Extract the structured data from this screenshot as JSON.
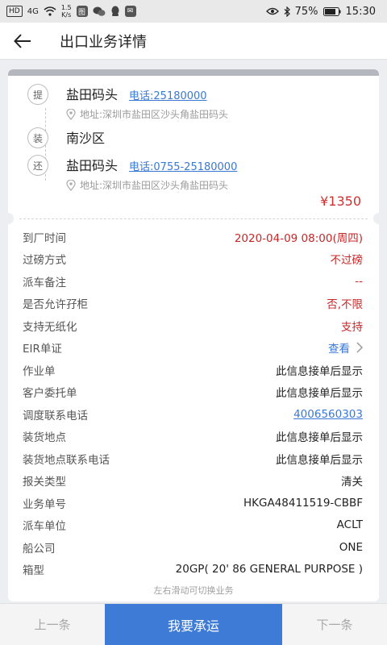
{
  "status_bar": {
    "hd_label": "HD",
    "network": "4G",
    "speed": "1.5\nK/s",
    "battery": "75%",
    "time": "15:30"
  },
  "header": {
    "title": "出口业务详情"
  },
  "route": {
    "pickup": {
      "badge": "提",
      "name": "盐田码头",
      "phone": "电话:25180000",
      "address": "地址:深圳市盐田区沙头角盐田码头"
    },
    "load": {
      "badge": "装",
      "name": "南沙区"
    },
    "return": {
      "badge": "还",
      "name": "盐田码头",
      "phone": "电话:0755-25180000",
      "address": "地址:深圳市盐田区沙头角盐田码头"
    },
    "price": "¥1350"
  },
  "details": [
    {
      "label": "到厂时间",
      "value": "2020-04-09 08:00(周四)",
      "style": "red"
    },
    {
      "label": "过磅方式",
      "value": "不过磅",
      "style": "red"
    },
    {
      "label": "派车备注",
      "value": "--",
      "style": "red"
    },
    {
      "label": "是否允许孖柜",
      "value": "否,不限",
      "style": "red"
    },
    {
      "label": "支持无纸化",
      "value": "支持",
      "style": "red"
    },
    {
      "label": "EIR单证",
      "value": "查看",
      "style": "blue-chevron"
    },
    {
      "label": "作业单",
      "value": "此信息接单后显示",
      "style": "normal"
    },
    {
      "label": "客户委托单",
      "value": "此信息接单后显示",
      "style": "normal"
    },
    {
      "label": "调度联系电话",
      "value": "4006560303",
      "style": "link"
    },
    {
      "label": "装货地点",
      "value": "此信息接单后显示",
      "style": "normal"
    },
    {
      "label": "装货地点联系电话",
      "value": "此信息接单后显示",
      "style": "normal"
    },
    {
      "label": "报关类型",
      "value": "清关",
      "style": "normal"
    },
    {
      "label": "业务单号",
      "value": "HKGA48411519-CBBF",
      "style": "normal"
    },
    {
      "label": "派车单位",
      "value": "ACLT",
      "style": "normal"
    },
    {
      "label": "船公司",
      "value": "ONE",
      "style": "normal"
    },
    {
      "label": "箱型",
      "value": "20GP( 20' 86 GENERAL PURPOSE )",
      "style": "normal"
    }
  ],
  "swipe_hint": "左右滑动可切换业务",
  "bottom": {
    "prev": "上一条",
    "accept": "我要承运",
    "next": "下一条"
  }
}
